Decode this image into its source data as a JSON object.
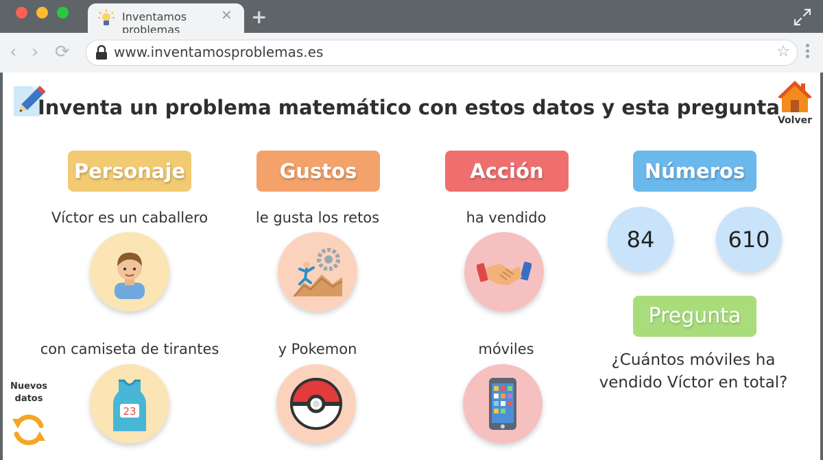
{
  "browser": {
    "tab_title": "Inventamos problemas",
    "url": "www.inventamosproblemas.es"
  },
  "page": {
    "heading": "Inventa un problema matemático con estos datos y esta pregunta",
    "home_label": "Volver",
    "new_data_line1": "Nuevos",
    "new_data_line2": "datos"
  },
  "categories": {
    "personaje": "Personaje",
    "gustos": "Gustos",
    "accion": "Acción",
    "numeros": "Números",
    "pregunta": "Pregunta"
  },
  "personaje": {
    "phrase1": "Víctor es un caballero",
    "phrase2": "con camiseta de tirantes",
    "shirt_number": "23"
  },
  "gustos": {
    "phrase1": "le gusta los retos",
    "phrase2": "y Pokemon"
  },
  "accion": {
    "phrase1": "ha vendido",
    "phrase2": "móviles"
  },
  "numeros": [
    "84",
    "610"
  ],
  "pregunta": {
    "line1": "¿Cuántos móviles ha",
    "line2": "vendido Víctor en total?"
  },
  "colors": {
    "personaje": "#f2ca72",
    "gustos": "#f4a26b",
    "accion": "#ef6f6f",
    "numeros": "#6bb8ec",
    "pregunta": "#a9dd7c"
  }
}
